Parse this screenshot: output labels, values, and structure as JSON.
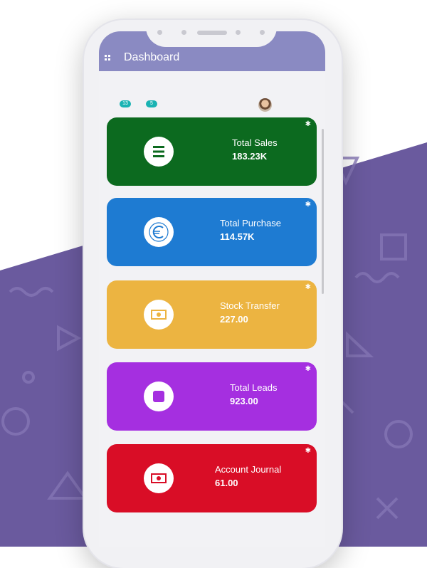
{
  "appbar": {
    "title": "Dashboard"
  },
  "subbar": {
    "badge_1": "13",
    "badge_2": "5"
  },
  "cards": [
    {
      "label": "Total Sales",
      "value": "183.23K",
      "color": "#0c6a1f",
      "icon": "menu-lines-icon"
    },
    {
      "label": "Total Purchase",
      "value": "114.57K",
      "color": "#1e7bd2",
      "icon": "euro-coin-icon"
    },
    {
      "label": "Stock Transfer",
      "value": "227.00",
      "color": "#ecb441",
      "icon": "banknote-icon"
    },
    {
      "label": "Total Leads",
      "value": "923.00",
      "color": "#a52fe0",
      "icon": "stop-square-icon"
    },
    {
      "label": "Account Journal",
      "value": "61.00",
      "color": "#d90d26",
      "icon": "banknote-icon"
    }
  ],
  "colors": {
    "appbar": "#8a8ac2",
    "background": "#6a5a9e",
    "badge": "#1ab3b3"
  }
}
